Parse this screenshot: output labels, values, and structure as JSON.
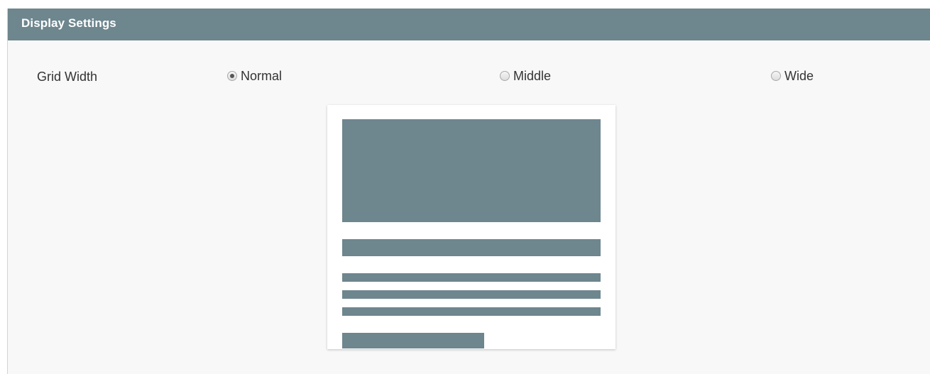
{
  "panel": {
    "title": "Display Settings"
  },
  "grid_width": {
    "label": "Grid Width",
    "options": [
      {
        "label": "Normal",
        "checked": true
      },
      {
        "label": "Middle",
        "checked": false
      },
      {
        "label": "Wide",
        "checked": false
      }
    ]
  },
  "preview": {
    "icon": "grid-layout-preview",
    "color": "#6e868e"
  },
  "colors": {
    "header_bg": "#6e868e",
    "panel_bg": "#f8f8f8",
    "text": "#333333"
  }
}
